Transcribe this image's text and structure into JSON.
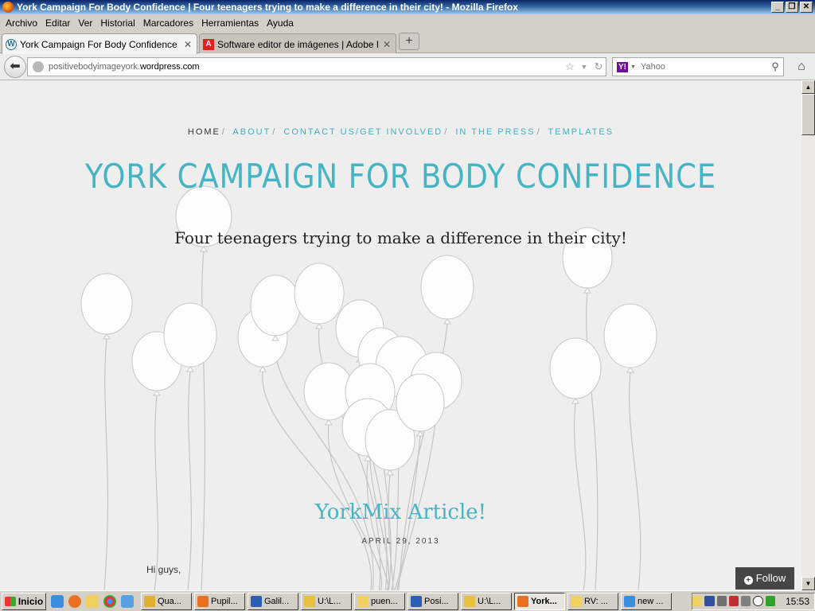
{
  "window": {
    "title": "York Campaign For Body Confidence | Four teenagers trying to make a difference in their city! - Mozilla Firefox",
    "buttons": {
      "minimize": "_",
      "maximize": "❐",
      "close": "✕"
    }
  },
  "menu": [
    "Archivo",
    "Editar",
    "Ver",
    "Historial",
    "Marcadores",
    "Herramientas",
    "Ayuda"
  ],
  "tabs": [
    {
      "label": "York Campaign For Body Confidence | Fo...",
      "icon": "wordpress-icon",
      "active": true
    },
    {
      "label": "Software editor de imágenes | Adobe Ph...",
      "icon": "adobe-icon",
      "active": false
    }
  ],
  "newtab_label": "+",
  "nav": {
    "url_plain": "positivebodyimageyork.",
    "url_domain": "wordpress.com",
    "search_placeholder": "Yahoo",
    "search_engine_letter": "Y!"
  },
  "site": {
    "nav": [
      "Home",
      "About",
      "Contact Us/Get Involved",
      "In the Press",
      "Templates"
    ],
    "nav_separator": "/",
    "title": "YORK CAMPAIGN FOR BODY CONFIDENCE",
    "tagline": "Four teenagers trying to make a difference in their city!",
    "accent_color": "#45b5c4"
  },
  "post": {
    "title": "YorkMix Article!",
    "date": "APRIL 29, 2013",
    "body_start": "Hi guys,"
  },
  "follow": {
    "label": "Follow"
  },
  "taskbar": {
    "start_label": "Inicio",
    "buttons": [
      {
        "label": "Qua...",
        "active": false,
        "color": "#e0b030"
      },
      {
        "label": "Pupil...",
        "active": false,
        "color": "#e87020"
      },
      {
        "label": "Galil...",
        "active": false,
        "color": "#2b5fb3"
      },
      {
        "label": "U:\\L...",
        "active": false,
        "color": "#e8c040"
      },
      {
        "label": "puen...",
        "active": false,
        "color": "#f0d060"
      },
      {
        "label": "Posi...",
        "active": false,
        "color": "#2b5fb3"
      },
      {
        "label": "U:\\L...",
        "active": false,
        "color": "#e8c040"
      },
      {
        "label": "York...",
        "active": true,
        "color": "#e87020"
      },
      {
        "label": "RV: ...",
        "active": false,
        "color": "#f0d060"
      },
      {
        "label": "new ...",
        "active": false,
        "color": "#3a8ee0"
      }
    ],
    "clock": "15:53"
  }
}
